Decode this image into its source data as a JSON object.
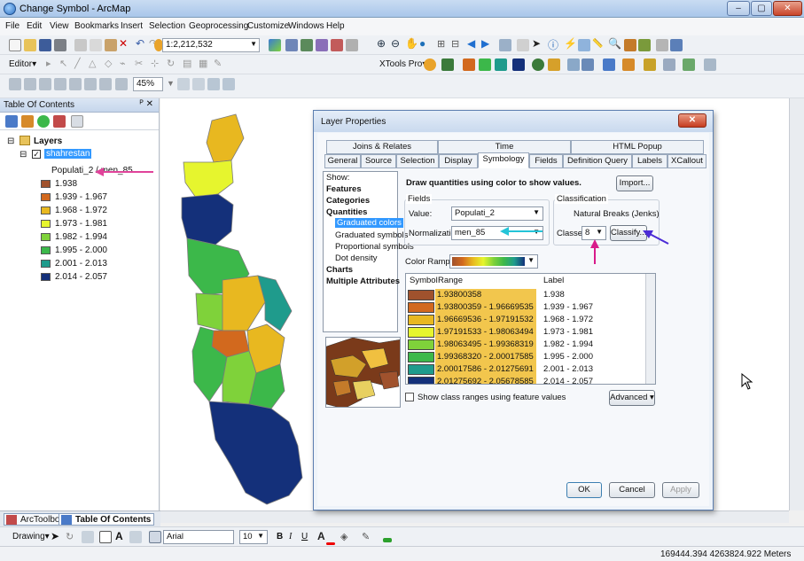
{
  "window": {
    "title": "Change Symbol - ArcMap",
    "min": "–",
    "max": "▢",
    "close": "✕"
  },
  "menu": [
    "File",
    "Edit",
    "View",
    "Bookmarks",
    "Insert",
    "Selection",
    "Geoprocessing",
    "Customize",
    "Windows",
    "Help"
  ],
  "toolbar": {
    "scale": "1:2,212,532",
    "editor_label": "Editor▾",
    "xtools_label": "XTools Pro▾",
    "zoom": "45%"
  },
  "toc": {
    "title": "Table Of Contents",
    "pin_close": "ᴾ ✕",
    "layers_label": "Layers",
    "layer_name": "shahrestan",
    "field_label": "Populati_2 / men_85",
    "legend": [
      {
        "label": "1.938",
        "color": "#a0522d"
      },
      {
        "label": "1.939 - 1.967",
        "color": "#d2691e"
      },
      {
        "label": "1.968 - 1.972",
        "color": "#e8b820"
      },
      {
        "label": "1.973 - 1.981",
        "color": "#e6f52e"
      },
      {
        "label": "1.982 - 1.994",
        "color": "#7fd23a"
      },
      {
        "label": "1.995 - 2.000",
        "color": "#3cb84a"
      },
      {
        "label": "2.001 - 2.013",
        "color": "#1f9b8c"
      },
      {
        "label": "2.014 - 2.057",
        "color": "#14307a"
      }
    ]
  },
  "bottom_tabs": {
    "arctoolbox": "ArcToolbox",
    "toc": "Table Of Contents"
  },
  "drawbar": {
    "drawing": "Drawing▾",
    "font": "Arial",
    "size": "10",
    "bold": "B",
    "italic": "I",
    "underline": "U"
  },
  "status": {
    "coords": "169444.394  4263824.922 Meters"
  },
  "dialog": {
    "title": "Layer Properties",
    "tabs_row1": [
      "Joins & Relates",
      "Time",
      "HTML Popup"
    ],
    "tabs_row2": [
      "General",
      "Source",
      "Selection",
      "Display",
      "Symbology",
      "Fields",
      "Definition Query",
      "Labels",
      "XCallout"
    ],
    "show_label": "Show:",
    "show_items": [
      "Features",
      "Categories",
      "Quantities",
      "Graduated colors",
      "Graduated symbols",
      "Proportional symbols",
      "Dot density",
      "Charts",
      "Multiple Attributes"
    ],
    "heading": "Draw quantities using color to show values.",
    "import_btn": "Import...",
    "fields_group": "Fields",
    "value_label": "Value:",
    "value_field": "Populati_2",
    "norm_label": "Normalization:",
    "norm_field": "men_85",
    "classification_group": "Classification",
    "method": "Natural Breaks (Jenks)",
    "classes_label": "Classes:",
    "classes_value": "8",
    "classify_btn": "Classify...",
    "color_ramp_label": "Color Ramp:",
    "table_headers": [
      "Symbol",
      "Range",
      "Label"
    ],
    "rows": [
      {
        "range": "1.93800358",
        "label": "1.938",
        "color": "#a0522d"
      },
      {
        "range": "1.93800359 - 1.96669535",
        "label": "1.939 - 1.967",
        "color": "#d2691e"
      },
      {
        "range": "1.96669536 - 1.97191532",
        "label": "1.968 - 1.972",
        "color": "#e8b820"
      },
      {
        "range": "1.97191533 - 1.98063494",
        "label": "1.973 - 1.981",
        "color": "#e6f52e"
      },
      {
        "range": "1.98063495 - 1.99368319",
        "label": "1.982 - 1.994",
        "color": "#7fd23a"
      },
      {
        "range": "1.99368320 - 2.00017585",
        "label": "1.995 - 2.000",
        "color": "#3cb84a"
      },
      {
        "range": "2.00017586 - 2.01275691",
        "label": "2.001 - 2.013",
        "color": "#1f9b8c"
      },
      {
        "range": "2.01275692 - 2.05678585",
        "label": "2.014 - 2.057",
        "color": "#14307a"
      }
    ],
    "show_ranges_checkbox": "Show class ranges using feature values",
    "advanced_btn": "Advanced ▾",
    "ok_btn": "OK",
    "cancel_btn": "Cancel",
    "apply_btn": "Apply"
  }
}
